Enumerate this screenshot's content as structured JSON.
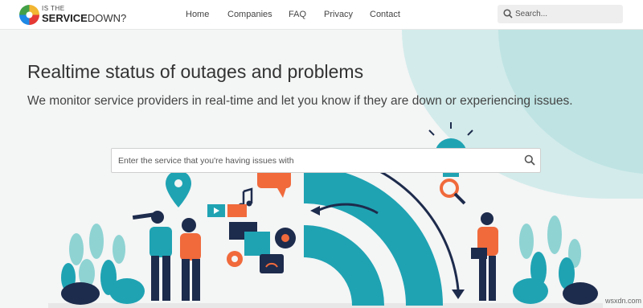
{
  "logo": {
    "line1": "IS THE",
    "line2a": "SERVICE",
    "line2b": "DOWN?"
  },
  "nav": [
    {
      "label": "Home"
    },
    {
      "label": "Companies"
    },
    {
      "label": "FAQ"
    },
    {
      "label": "Privacy"
    },
    {
      "label": "Contact"
    }
  ],
  "header_search": {
    "placeholder": "Search..."
  },
  "hero": {
    "title": "Realtime status of outages and problems",
    "subtitle": "We monitor service providers in real-time and let you know if they are down or experiencing issues."
  },
  "main_search": {
    "placeholder": "Enter the service that you're having issues with"
  },
  "watermark": "wsxdn.com",
  "colors": {
    "teal": "#1fa3b3",
    "orange": "#f06a3c",
    "navy": "#1d2b4c",
    "blob": "#cfeaea"
  }
}
